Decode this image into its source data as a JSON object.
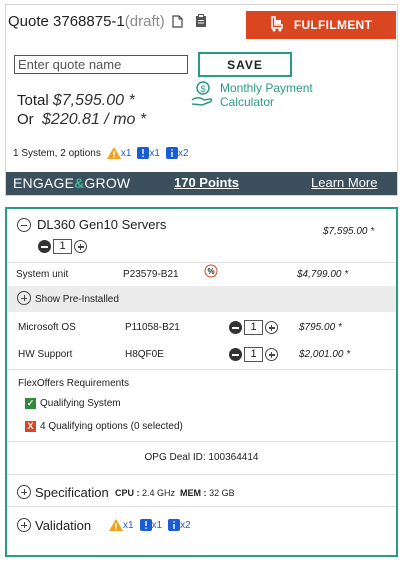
{
  "quote": {
    "label": "Quote 3768875-1",
    "draft": "(draft)",
    "fulfilment_label": "FULFILMENT",
    "name_placeholder": "Enter quote name",
    "save_label": "SAVE",
    "total_label": "Total",
    "total_value": "$7,595.00 *",
    "or_label": "Or",
    "monthly_value": "$220.81 / mo *",
    "monthly_calc_line1": "Monthly Payment",
    "monthly_calc_line2": "Calculator",
    "summary_text": "1 System, 2 options",
    "alerts": {
      "warning_count": "x1",
      "error_count": "x1",
      "info_count": "x2"
    }
  },
  "engage": {
    "logo_left": "ENGAGE",
    "logo_amp": "&",
    "logo_right": "GROW",
    "points": "170 Points",
    "learn_more": "Learn More"
  },
  "product": {
    "title": "DL360 Gen10 Servers",
    "price": "$7,595.00 *",
    "qty": "1",
    "system_unit": {
      "label": "System unit",
      "sku": "P23579-B21",
      "price": "$4,799.00 *"
    },
    "show_preinstalled": "Show Pre-Installed",
    "options": [
      {
        "label": "Microsoft OS",
        "sku": "P11058-B21",
        "qty": "1",
        "price": "$795.00 *"
      },
      {
        "label": "HW Support",
        "sku": "H8QF0E",
        "qty": "1",
        "price": "$2,001.00 *"
      }
    ],
    "flexoffers_title": "FlexOffers Requirements",
    "qualifying_system": "Qualifying System",
    "qualifying_options": "4 Qualifying options (0 selected)",
    "opg_deal": "OPG Deal ID: 100364414",
    "specification_label": "Specification",
    "cpu_label": "CPU :",
    "cpu_value": "2.4 GHz",
    "mem_label": "MEM :",
    "mem_value": "32 GB",
    "validation_label": "Validation",
    "validation_alerts": {
      "warning_count": "x1",
      "error_count": "x1",
      "info_count": "x2"
    }
  },
  "colors": {
    "accent": "#2a9b83",
    "orange": "#d9461f",
    "bar": "#3b4f5c"
  }
}
